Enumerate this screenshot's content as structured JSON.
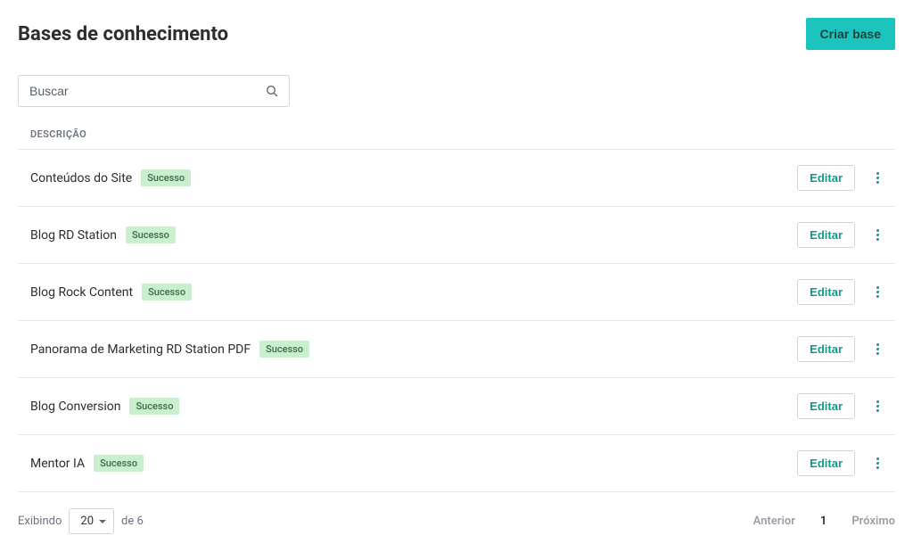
{
  "header": {
    "title": "Bases de conhecimento",
    "create_label": "Criar base"
  },
  "search": {
    "placeholder": "Buscar"
  },
  "table": {
    "column_header": "DESCRIÇÃO",
    "edit_label": "Editar",
    "badge_success": "Sucesso",
    "rows": [
      {
        "name": "Conteúdos do Site",
        "status": "Sucesso"
      },
      {
        "name": "Blog RD Station",
        "status": "Sucesso"
      },
      {
        "name": "Blog Rock Content",
        "status": "Sucesso"
      },
      {
        "name": "Panorama de Marketing RD Station PDF",
        "status": "Sucesso"
      },
      {
        "name": "Blog Conversion",
        "status": "Sucesso"
      },
      {
        "name": "Mentor IA",
        "status": "Sucesso"
      }
    ]
  },
  "pagination": {
    "showing_label": "Exibindo",
    "page_size": "20",
    "of_label": "de 6",
    "prev_label": "Anterior",
    "current_page": "1",
    "next_label": "Próximo"
  }
}
